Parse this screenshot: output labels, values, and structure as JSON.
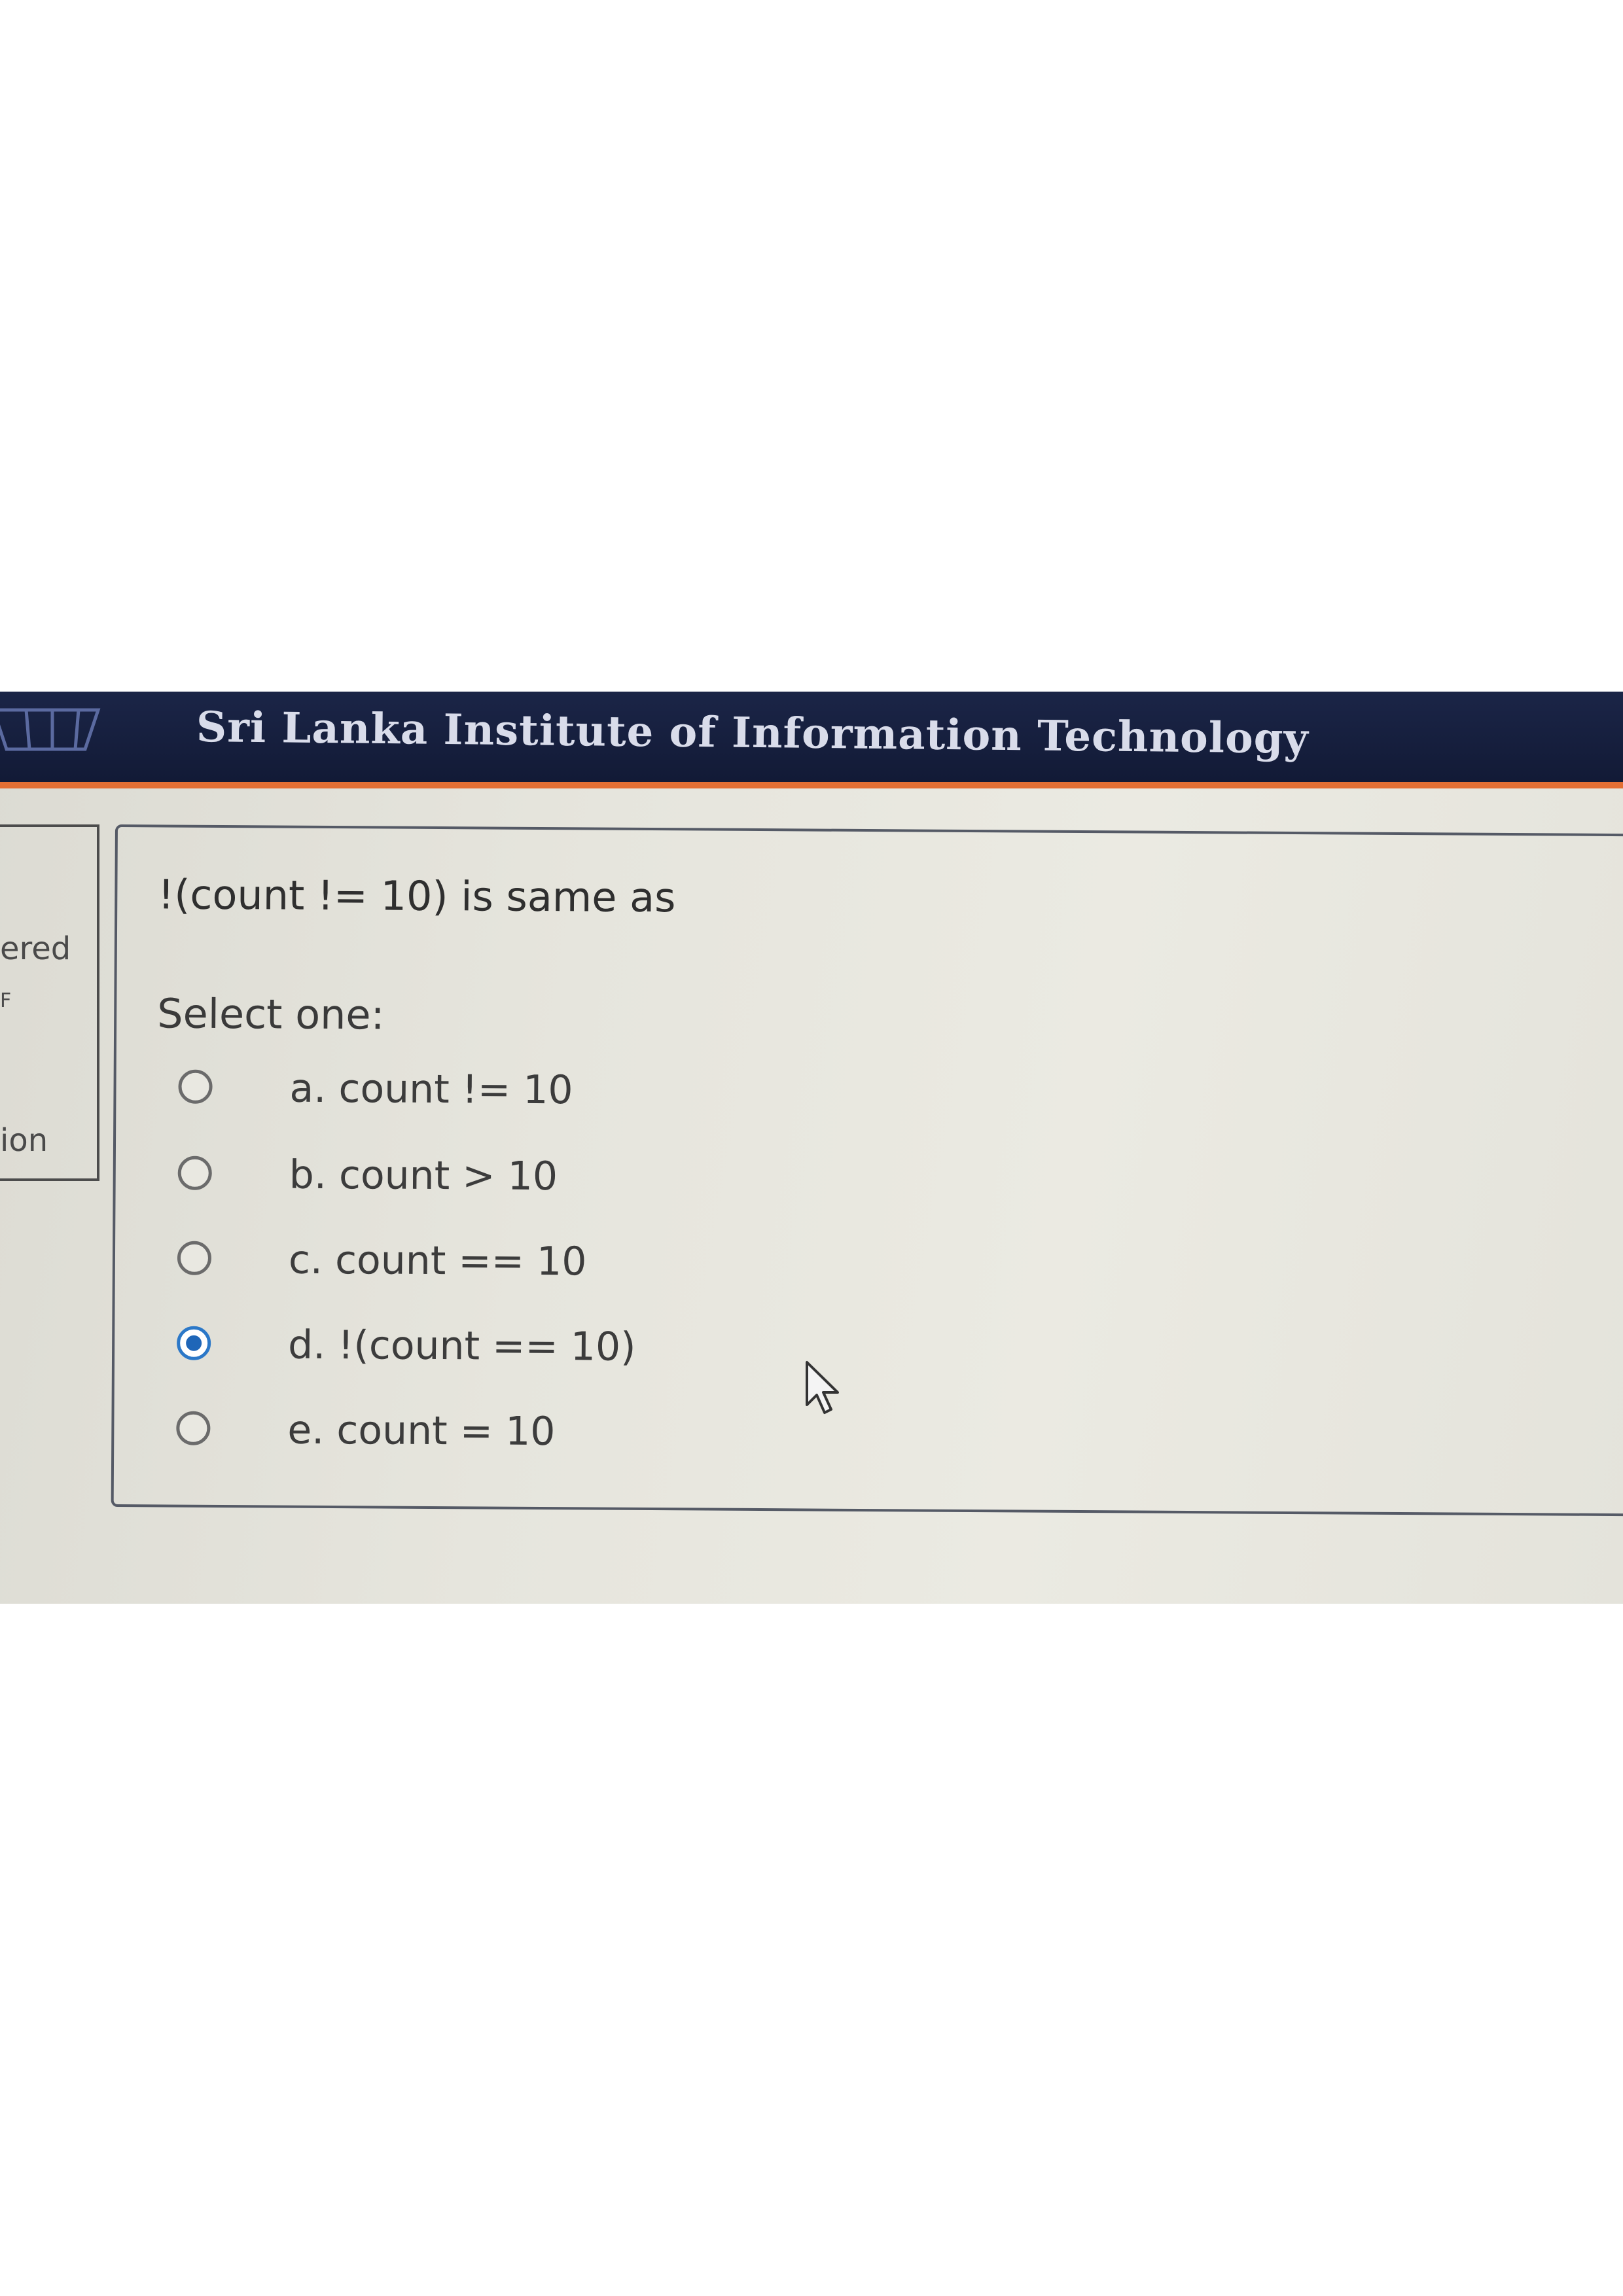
{
  "header": {
    "institute_name": "Sri Lanka Institute of Information Technology",
    "accent_color": "#e36f34",
    "bar_color": "#1b2547"
  },
  "side_nav": {
    "fragments": [
      "ered",
      "F",
      "ion"
    ]
  },
  "question": {
    "text": "!(count != 10) is same as",
    "select_label": "Select one:",
    "options": [
      {
        "label": "a. count != 10",
        "selected": false
      },
      {
        "label": "b. count > 10",
        "selected": false
      },
      {
        "label": "c. count == 10",
        "selected": false
      },
      {
        "label": "d. !(count == 10)",
        "selected": true
      },
      {
        "label": "e. count = 10",
        "selected": false
      }
    ],
    "selected_index": 3
  },
  "icons": {
    "cursor": "mouse-pointer-icon",
    "logo": "institute-logo"
  }
}
